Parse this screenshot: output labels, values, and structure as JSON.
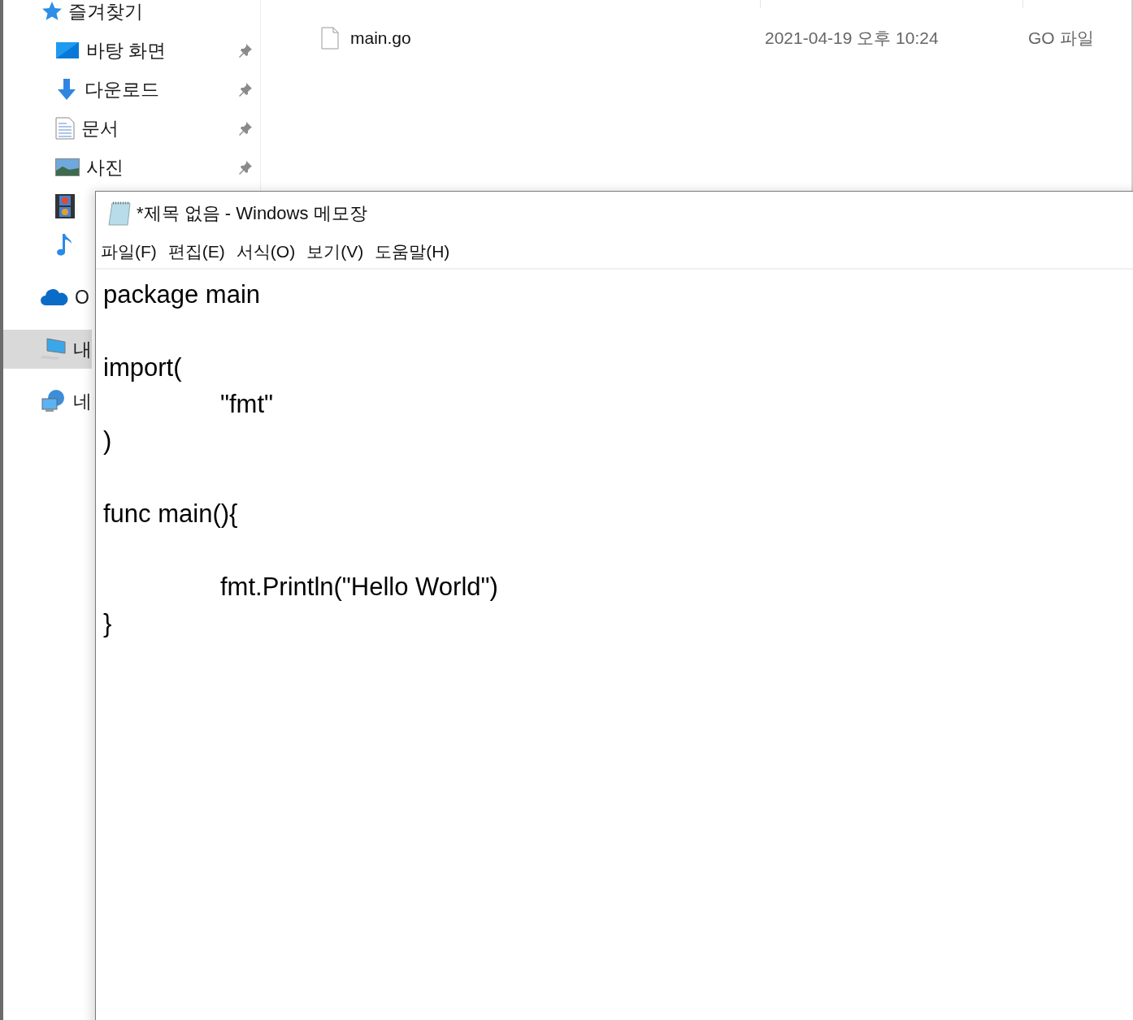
{
  "explorer": {
    "sidebar": {
      "items": [
        {
          "label": "즐겨찾기",
          "kind": "star",
          "selected": false,
          "pinned": false,
          "child": false
        },
        {
          "label": "바탕 화면",
          "kind": "desktop",
          "selected": false,
          "pinned": true,
          "child": true
        },
        {
          "label": "다운로드",
          "kind": "download",
          "selected": false,
          "pinned": true,
          "child": true
        },
        {
          "label": "문서",
          "kind": "document",
          "selected": false,
          "pinned": true,
          "child": true
        },
        {
          "label": "사진",
          "kind": "photo",
          "selected": false,
          "pinned": true,
          "child": true
        },
        {
          "kind": "video",
          "selected": false,
          "pinned": false,
          "child": true
        },
        {
          "kind": "music",
          "selected": false,
          "pinned": false,
          "child": true
        },
        {
          "label": "O",
          "kind": "cloud",
          "selected": false,
          "pinned": false,
          "child": false
        },
        {
          "label": "내",
          "kind": "pc",
          "selected": true,
          "pinned": false,
          "child": false
        },
        {
          "label": "네",
          "kind": "network",
          "selected": false,
          "pinned": false,
          "child": false
        }
      ]
    },
    "files": [
      {
        "name": "main.go",
        "modified": "2021-04-19 오후 10:24",
        "type": "GO 파일"
      }
    ]
  },
  "notepad": {
    "title": "*제목 없음 - Windows 메모장",
    "menu": [
      "파일(F)",
      "편집(E)",
      "서식(O)",
      "보기(V)",
      "도움말(H)"
    ],
    "text": "package main\n\nimport(\n\t\"fmt\"\n)\n\nfunc main(){\n\n\tfmt.Println(\"Hello World\")\n}"
  }
}
